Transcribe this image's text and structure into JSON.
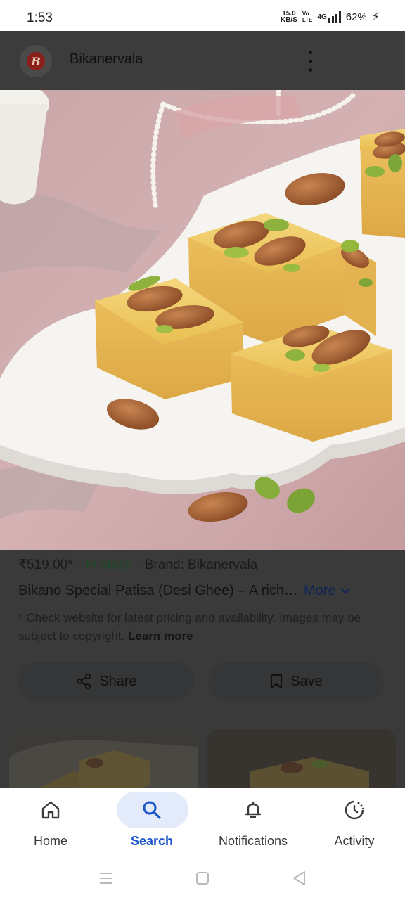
{
  "status_bar": {
    "time": "1:53",
    "net_speed_value": "15.0",
    "net_speed_unit": "KB/S",
    "volte_top": "Vo",
    "volte_bottom": "LTE",
    "network": "4G",
    "battery": "62%"
  },
  "header": {
    "site_name": "Bikanervala",
    "logo_letter": "B",
    "more_icon": "more-vert-icon"
  },
  "product": {
    "image_icon": "product-photo",
    "price": "₹519.00*",
    "separator": "·",
    "stock": "In stock",
    "brand": "Brand: Bikanervala",
    "title": "Bikano Special Patisa (Desi Ghee) – A rich…",
    "more_label": "More",
    "disclaimer": "* Check website for latest pricing and availability. Images may be subject to copyright.",
    "learn_more": "Learn more"
  },
  "actions": {
    "share_label": "Share",
    "share_icon": "share-icon",
    "save_label": "Save",
    "save_icon": "bookmark-icon"
  },
  "bottom_nav": {
    "items": [
      {
        "label": "Home",
        "icon": "home-icon"
      },
      {
        "label": "Search",
        "icon": "search-icon"
      },
      {
        "label": "Notifications",
        "icon": "bell-icon"
      },
      {
        "label": "Activity",
        "icon": "activity-icon"
      }
    ],
    "active": "Search",
    "active_color": "#1a56c8",
    "pill_color": "#e3ebfb"
  },
  "system_nav": {
    "menu_icon": "recents-icon",
    "home_icon": "home-square-icon",
    "back_icon": "back-triangle-icon"
  },
  "colors": {
    "overlay": "#3a3a3a",
    "in_stock": "#1c4a24",
    "link": "#0f2752"
  }
}
